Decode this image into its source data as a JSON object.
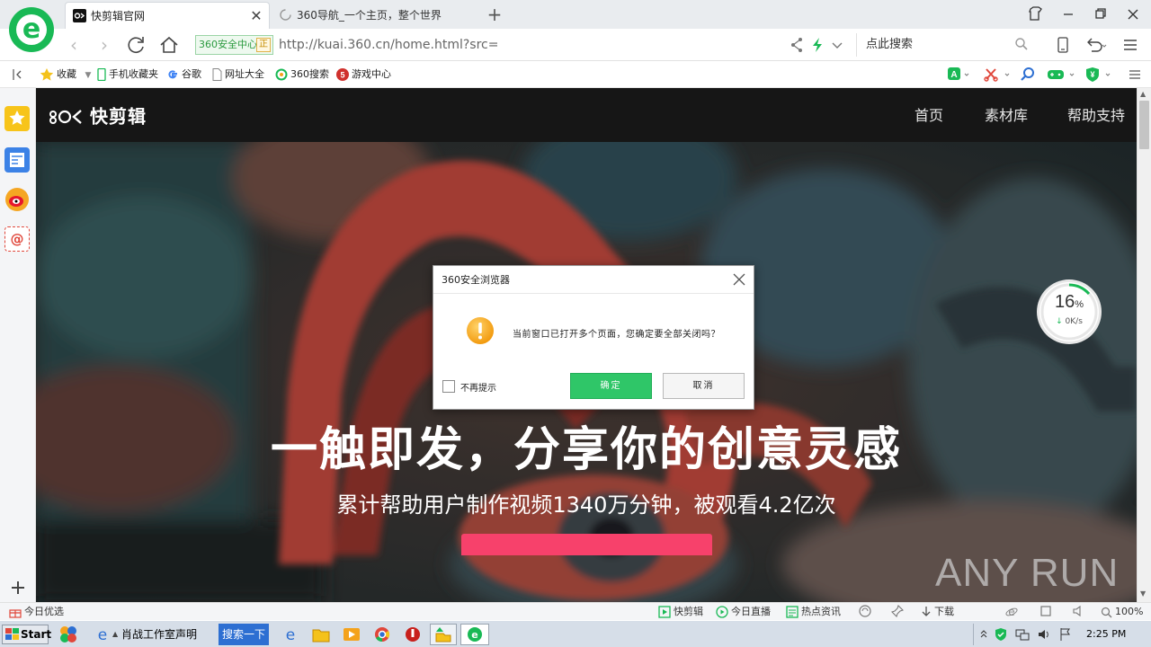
{
  "browser": {
    "tabs": [
      {
        "title": "快剪辑官网",
        "active": true
      },
      {
        "title": "360导航_一个主页，整个世界",
        "active": false
      }
    ],
    "new_tab_symbol": "+",
    "security_badge": "360安全中心",
    "security_badge_mark": "正",
    "address": "http://kuai.360.cn/home.html?src=",
    "search_placeholder": "点此搜索"
  },
  "bookmarks": [
    {
      "label": "收藏",
      "icon": "star-icon"
    },
    {
      "label": "手机收藏夹",
      "icon": "phone-icon"
    },
    {
      "label": "谷歌",
      "icon": "google-icon"
    },
    {
      "label": "网址大全",
      "icon": "page-icon"
    },
    {
      "label": "360搜索",
      "icon": "360-search-icon"
    },
    {
      "label": "游戏中心",
      "icon": "game-center-icon"
    }
  ],
  "site": {
    "logo": "快剪辑",
    "nav": [
      "首页",
      "素材库",
      "帮助支持"
    ],
    "headline": "一触即发，分享你的创意灵感",
    "subheadline": "累计帮助用户制作视频1340万分钟，被观看4.2亿次"
  },
  "speed_widget": {
    "percent": "16",
    "percent_sign": "%",
    "rate": "0K/s"
  },
  "dialog": {
    "title": "360安全浏览器",
    "message": "当前窗口已打开多个页面，您确定要全部关闭吗？",
    "checkbox_label": "不再提示",
    "ok": "确定",
    "cancel": "取消"
  },
  "statusbar": {
    "left": "今日优选",
    "items": [
      "快剪辑",
      "今日直播",
      "热点资讯",
      "下载"
    ],
    "zoom": "100%"
  },
  "taskbar": {
    "start": "Start",
    "ie_window": "肖战工作室声明",
    "search_button": "搜索一下",
    "time": "2:25 PM"
  },
  "watermark": "ANY RUN",
  "colors": {
    "brand_green": "#19b955",
    "ok_button": "#2fc668",
    "hero_button": "#f7416b"
  }
}
